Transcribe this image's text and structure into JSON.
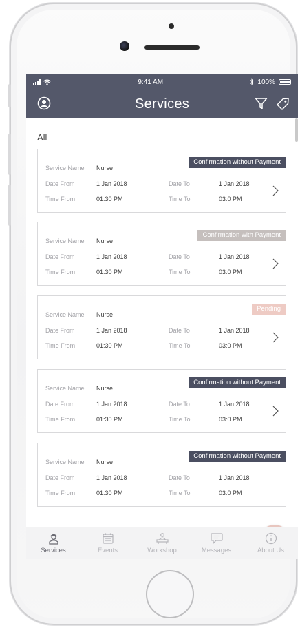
{
  "status_bar": {
    "time": "9:41 AM",
    "battery": "100%"
  },
  "header": {
    "title": "Services"
  },
  "filter_label": "All",
  "labels": {
    "service_name": "Service Name",
    "date_from": "Date From",
    "date_to": "Date To",
    "time_from": "Time From",
    "time_to": "Time To"
  },
  "cards": [
    {
      "status": "Confirmation without Payment",
      "service_name": "Nurse",
      "date_from": "1 Jan 2018",
      "date_to": "1 Jan 2018",
      "time_from": "01:30 PM",
      "time_to": "03:0 PM"
    },
    {
      "status": "Confirmation with Payment",
      "service_name": "Nurse",
      "date_from": "1 Jan 2018",
      "date_to": "1 Jan 2018",
      "time_from": "01:30 PM",
      "time_to": "03:0 PM"
    },
    {
      "status": "Pending",
      "service_name": "Nurse",
      "date_from": "1 Jan 2018",
      "date_to": "1 Jan 2018",
      "time_from": "01:30 PM",
      "time_to": "03:0 PM"
    },
    {
      "status": "Confirmation without Payment",
      "service_name": "Nurse",
      "date_from": "1 Jan 2018",
      "date_to": "1 Jan 2018",
      "time_from": "01:30 PM",
      "time_to": "03:0 PM"
    },
    {
      "status": "Confirmation without Payment",
      "service_name": "Nurse",
      "date_from": "1 Jan 2018",
      "date_to": "1 Jan 2018",
      "time_from": "01:30 PM",
      "time_to": "03:0 PM"
    }
  ],
  "tabs": [
    {
      "label": "Services",
      "icon": "nurse-icon"
    },
    {
      "label": "Events",
      "icon": "calendar-icon"
    },
    {
      "label": "Workshop",
      "icon": "workshop-icon"
    },
    {
      "label": "Messages",
      "icon": "message-icon"
    },
    {
      "label": "About Us",
      "icon": "info-icon"
    }
  ],
  "colors": {
    "header": "#54586a",
    "badge_dark": "#4b4f61",
    "badge_light": "#c5bfbd",
    "badge_pending": "#eecbc4",
    "fab": "#e8c6bf"
  }
}
